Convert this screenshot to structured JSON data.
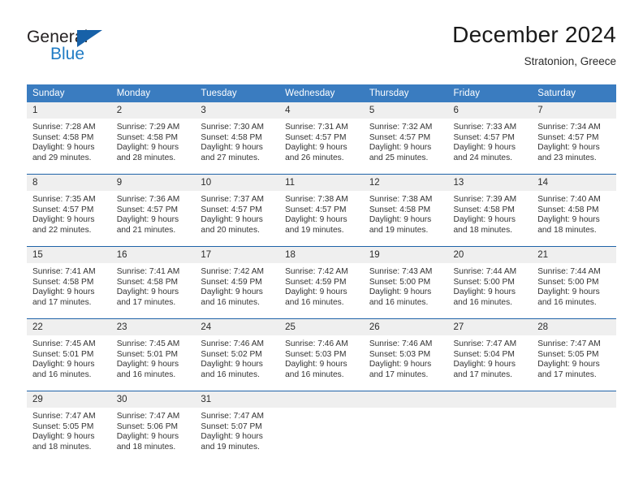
{
  "brand": {
    "word_one": "General",
    "word_two": "Blue",
    "logo_icon": "blue-triangle-logo",
    "accent_color": "#1761a8",
    "blue_text_color": "#1f7bc4"
  },
  "header": {
    "title": "December 2024",
    "location": "Stratonion, Greece"
  },
  "calendar": {
    "header_bg": "#3a7cc0",
    "daynum_bg": "#efefef",
    "row_divider_color": "#1f63a8",
    "weekday_headers": [
      "Sunday",
      "Monday",
      "Tuesday",
      "Wednesday",
      "Thursday",
      "Friday",
      "Saturday"
    ],
    "weeks": [
      [
        {
          "day": "1",
          "sunrise": "Sunrise: 7:28 AM",
          "sunset": "Sunset: 4:58 PM",
          "daylight_line1": "Daylight: 9 hours",
          "daylight_line2": "and 29 minutes."
        },
        {
          "day": "2",
          "sunrise": "Sunrise: 7:29 AM",
          "sunset": "Sunset: 4:58 PM",
          "daylight_line1": "Daylight: 9 hours",
          "daylight_line2": "and 28 minutes."
        },
        {
          "day": "3",
          "sunrise": "Sunrise: 7:30 AM",
          "sunset": "Sunset: 4:58 PM",
          "daylight_line1": "Daylight: 9 hours",
          "daylight_line2": "and 27 minutes."
        },
        {
          "day": "4",
          "sunrise": "Sunrise: 7:31 AM",
          "sunset": "Sunset: 4:57 PM",
          "daylight_line1": "Daylight: 9 hours",
          "daylight_line2": "and 26 minutes."
        },
        {
          "day": "5",
          "sunrise": "Sunrise: 7:32 AM",
          "sunset": "Sunset: 4:57 PM",
          "daylight_line1": "Daylight: 9 hours",
          "daylight_line2": "and 25 minutes."
        },
        {
          "day": "6",
          "sunrise": "Sunrise: 7:33 AM",
          "sunset": "Sunset: 4:57 PM",
          "daylight_line1": "Daylight: 9 hours",
          "daylight_line2": "and 24 minutes."
        },
        {
          "day": "7",
          "sunrise": "Sunrise: 7:34 AM",
          "sunset": "Sunset: 4:57 PM",
          "daylight_line1": "Daylight: 9 hours",
          "daylight_line2": "and 23 minutes."
        }
      ],
      [
        {
          "day": "8",
          "sunrise": "Sunrise: 7:35 AM",
          "sunset": "Sunset: 4:57 PM",
          "daylight_line1": "Daylight: 9 hours",
          "daylight_line2": "and 22 minutes."
        },
        {
          "day": "9",
          "sunrise": "Sunrise: 7:36 AM",
          "sunset": "Sunset: 4:57 PM",
          "daylight_line1": "Daylight: 9 hours",
          "daylight_line2": "and 21 minutes."
        },
        {
          "day": "10",
          "sunrise": "Sunrise: 7:37 AM",
          "sunset": "Sunset: 4:57 PM",
          "daylight_line1": "Daylight: 9 hours",
          "daylight_line2": "and 20 minutes."
        },
        {
          "day": "11",
          "sunrise": "Sunrise: 7:38 AM",
          "sunset": "Sunset: 4:57 PM",
          "daylight_line1": "Daylight: 9 hours",
          "daylight_line2": "and 19 minutes."
        },
        {
          "day": "12",
          "sunrise": "Sunrise: 7:38 AM",
          "sunset": "Sunset: 4:58 PM",
          "daylight_line1": "Daylight: 9 hours",
          "daylight_line2": "and 19 minutes."
        },
        {
          "day": "13",
          "sunrise": "Sunrise: 7:39 AM",
          "sunset": "Sunset: 4:58 PM",
          "daylight_line1": "Daylight: 9 hours",
          "daylight_line2": "and 18 minutes."
        },
        {
          "day": "14",
          "sunrise": "Sunrise: 7:40 AM",
          "sunset": "Sunset: 4:58 PM",
          "daylight_line1": "Daylight: 9 hours",
          "daylight_line2": "and 18 minutes."
        }
      ],
      [
        {
          "day": "15",
          "sunrise": "Sunrise: 7:41 AM",
          "sunset": "Sunset: 4:58 PM",
          "daylight_line1": "Daylight: 9 hours",
          "daylight_line2": "and 17 minutes."
        },
        {
          "day": "16",
          "sunrise": "Sunrise: 7:41 AM",
          "sunset": "Sunset: 4:58 PM",
          "daylight_line1": "Daylight: 9 hours",
          "daylight_line2": "and 17 minutes."
        },
        {
          "day": "17",
          "sunrise": "Sunrise: 7:42 AM",
          "sunset": "Sunset: 4:59 PM",
          "daylight_line1": "Daylight: 9 hours",
          "daylight_line2": "and 16 minutes."
        },
        {
          "day": "18",
          "sunrise": "Sunrise: 7:42 AM",
          "sunset": "Sunset: 4:59 PM",
          "daylight_line1": "Daylight: 9 hours",
          "daylight_line2": "and 16 minutes."
        },
        {
          "day": "19",
          "sunrise": "Sunrise: 7:43 AM",
          "sunset": "Sunset: 5:00 PM",
          "daylight_line1": "Daylight: 9 hours",
          "daylight_line2": "and 16 minutes."
        },
        {
          "day": "20",
          "sunrise": "Sunrise: 7:44 AM",
          "sunset": "Sunset: 5:00 PM",
          "daylight_line1": "Daylight: 9 hours",
          "daylight_line2": "and 16 minutes."
        },
        {
          "day": "21",
          "sunrise": "Sunrise: 7:44 AM",
          "sunset": "Sunset: 5:00 PM",
          "daylight_line1": "Daylight: 9 hours",
          "daylight_line2": "and 16 minutes."
        }
      ],
      [
        {
          "day": "22",
          "sunrise": "Sunrise: 7:45 AM",
          "sunset": "Sunset: 5:01 PM",
          "daylight_line1": "Daylight: 9 hours",
          "daylight_line2": "and 16 minutes."
        },
        {
          "day": "23",
          "sunrise": "Sunrise: 7:45 AM",
          "sunset": "Sunset: 5:01 PM",
          "daylight_line1": "Daylight: 9 hours",
          "daylight_line2": "and 16 minutes."
        },
        {
          "day": "24",
          "sunrise": "Sunrise: 7:46 AM",
          "sunset": "Sunset: 5:02 PM",
          "daylight_line1": "Daylight: 9 hours",
          "daylight_line2": "and 16 minutes."
        },
        {
          "day": "25",
          "sunrise": "Sunrise: 7:46 AM",
          "sunset": "Sunset: 5:03 PM",
          "daylight_line1": "Daylight: 9 hours",
          "daylight_line2": "and 16 minutes."
        },
        {
          "day": "26",
          "sunrise": "Sunrise: 7:46 AM",
          "sunset": "Sunset: 5:03 PM",
          "daylight_line1": "Daylight: 9 hours",
          "daylight_line2": "and 17 minutes."
        },
        {
          "day": "27",
          "sunrise": "Sunrise: 7:47 AM",
          "sunset": "Sunset: 5:04 PM",
          "daylight_line1": "Daylight: 9 hours",
          "daylight_line2": "and 17 minutes."
        },
        {
          "day": "28",
          "sunrise": "Sunrise: 7:47 AM",
          "sunset": "Sunset: 5:05 PM",
          "daylight_line1": "Daylight: 9 hours",
          "daylight_line2": "and 17 minutes."
        }
      ],
      [
        {
          "day": "29",
          "sunrise": "Sunrise: 7:47 AM",
          "sunset": "Sunset: 5:05 PM",
          "daylight_line1": "Daylight: 9 hours",
          "daylight_line2": "and 18 minutes."
        },
        {
          "day": "30",
          "sunrise": "Sunrise: 7:47 AM",
          "sunset": "Sunset: 5:06 PM",
          "daylight_line1": "Daylight: 9 hours",
          "daylight_line2": "and 18 minutes."
        },
        {
          "day": "31",
          "sunrise": "Sunrise: 7:47 AM",
          "sunset": "Sunset: 5:07 PM",
          "daylight_line1": "Daylight: 9 hours",
          "daylight_line2": "and 19 minutes."
        },
        {
          "day": "",
          "sunrise": "",
          "sunset": "",
          "daylight_line1": "",
          "daylight_line2": ""
        },
        {
          "day": "",
          "sunrise": "",
          "sunset": "",
          "daylight_line1": "",
          "daylight_line2": ""
        },
        {
          "day": "",
          "sunrise": "",
          "sunset": "",
          "daylight_line1": "",
          "daylight_line2": ""
        },
        {
          "day": "",
          "sunrise": "",
          "sunset": "",
          "daylight_line1": "",
          "daylight_line2": ""
        }
      ]
    ]
  }
}
